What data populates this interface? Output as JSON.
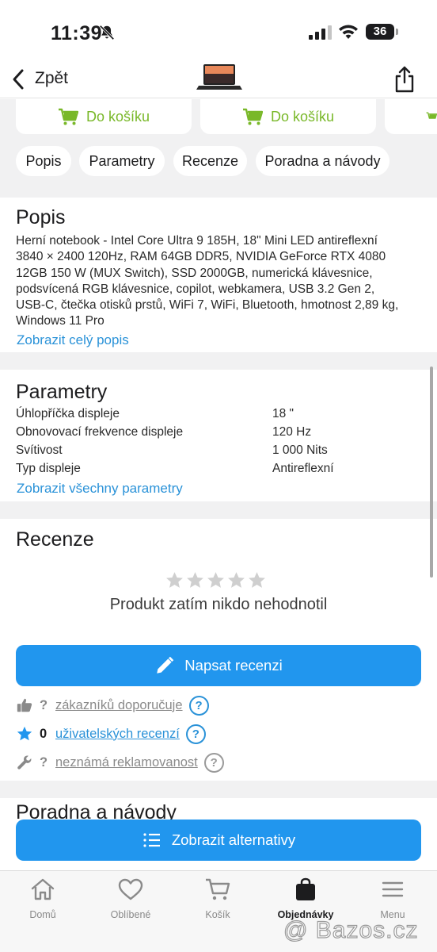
{
  "status_bar": {
    "time": "11:39",
    "battery": "36"
  },
  "nav": {
    "back_label": "Zpět"
  },
  "cart_label": "Do košíku",
  "chips": [
    "Popis",
    "Parametry",
    "Recenze",
    "Poradna a návody"
  ],
  "popis": {
    "title": "Popis",
    "lines": [
      "Herní notebook - Intel Core Ultra 9 185H,  18\" Mini LED antireflexní",
      "3840 × 2400 120Hz,  RAM  64GB DDR5,  NVIDIA GeForce RTX 4080",
      "12GB 150 W (MUX Switch),  SSD  2000GB,  numerická klávesnice,",
      "podsvícená RGB klávesnice, copilot,  webkamera,  USB 3.2 Gen 2,",
      "USB-C,  čtečka otisků prstů, WiFi 7,  WiFi,  Bluetooth, hmotnost 2,89 kg,",
      "Windows 11 Pro"
    ],
    "link": "Zobrazit celý popis"
  },
  "parametry": {
    "title": "Parametry",
    "rows": [
      {
        "name": "Úhlopříčka displeje",
        "value": "18 \""
      },
      {
        "name": "Obnovovací frekvence displeje",
        "value": "120 Hz"
      },
      {
        "name": "Svítivost",
        "value": "1 000 Nits"
      },
      {
        "name": "Typ displeje",
        "value": "Antireflexní"
      }
    ],
    "link": "Zobrazit všechny parametry"
  },
  "recenze": {
    "title": "Recenze",
    "rating_stars": 0,
    "no_rating": "Produkt zatím nikdo nehodnotil",
    "write_button": "Napsat recenzi",
    "stats": [
      {
        "count": "?",
        "label": "zákazníků doporučuje",
        "help": "?"
      },
      {
        "count": "0",
        "label": "uživatelských recenzí",
        "help": "?"
      },
      {
        "count": "?",
        "label": "neznámá reklamovanost",
        "help": "?"
      }
    ]
  },
  "poradna": {
    "title": "Poradna a návody"
  },
  "alternatives_button": "Zobrazit alternativy",
  "tabs": [
    {
      "label": "Domů",
      "icon": "home-icon"
    },
    {
      "label": "Oblíbené",
      "icon": "heart-icon"
    },
    {
      "label": "Košík",
      "icon": "cart-icon"
    },
    {
      "label": "Objednávky",
      "icon": "bag-icon",
      "active": true
    },
    {
      "label": "Menu",
      "icon": "menu-icon"
    }
  ],
  "watermark": "@ Bazos.cz",
  "colors": {
    "accent_green": "#79b829",
    "link_blue": "#2a92d8",
    "button_blue": "#2196ee"
  }
}
